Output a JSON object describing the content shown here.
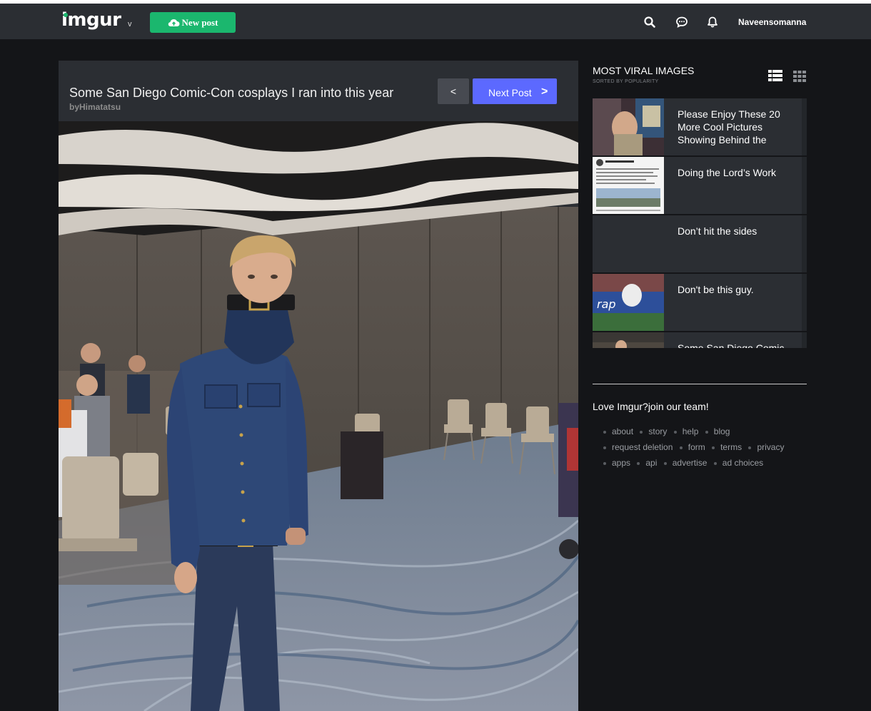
{
  "header": {
    "logo": "imgur",
    "logo_caret": "v",
    "new_post_label": "New post",
    "username": "Naveensomanna",
    "icons": [
      "search-icon",
      "chat-icon",
      "bell-icon",
      "cloud-upload-icon"
    ]
  },
  "post": {
    "title": "Some San Diego Comic-Con cosplays I ran into this year",
    "author": "byHimatatsu",
    "prev_label": "<",
    "next_label": "Next Post",
    "next_arrow": ">",
    "image_alt": "Cosplayer in denim shirt with belt around neck"
  },
  "sidebar": {
    "title": "MOST VIRAL IMAGES",
    "subtitle": "SORTED BY POPULARITY",
    "view_icons": [
      "list-view-icon",
      "grid-view-icon"
    ],
    "items": [
      {
        "title": "Please Enjoy These 20 More Cool Pictures Showing Behind the"
      },
      {
        "title": "Doing the Lord’s Work"
      },
      {
        "title": "Don’t hit the sides"
      },
      {
        "title": "Don't be this guy."
      },
      {
        "title": "Some San Diego Comic"
      }
    ]
  },
  "footer": {
    "love_text": "Love Imgur?join our team!",
    "rows": [
      [
        "about",
        "story",
        "help",
        "blog"
      ],
      [
        "request deletion",
        "form",
        "terms",
        "privacy"
      ],
      [
        "apps",
        "api",
        "advertise",
        "ad choices"
      ]
    ]
  },
  "colors": {
    "accent_green": "#1bb76e",
    "next_blue": "#5c69ff",
    "panel": "#2b2e33",
    "background": "#141518"
  }
}
